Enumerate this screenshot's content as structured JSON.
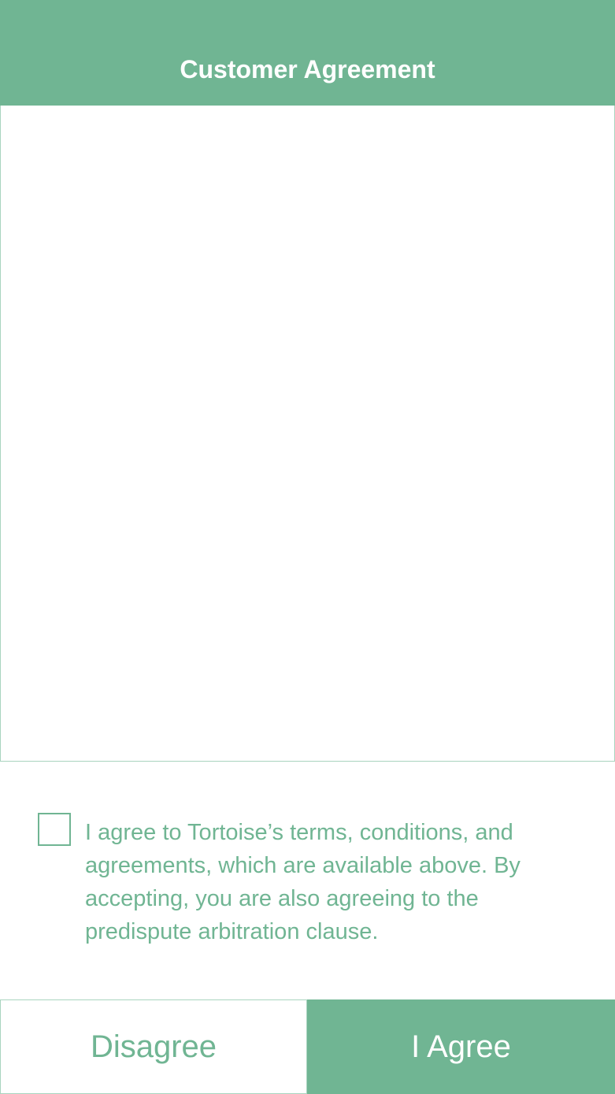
{
  "header": {
    "title": "Customer Agreement"
  },
  "agreement": {
    "body": ""
  },
  "consent": {
    "checked": false,
    "text": "I agree to Tortoise’s terms, conditions, and agreements, which are available above. By accepting, you are also agreeing to the predispute arbitration clause."
  },
  "actions": {
    "disagree_label": "Disagree",
    "agree_label": "I Agree"
  },
  "colors": {
    "accent": "#70b593",
    "border": "#a9d4bf",
    "background": "#ffffff"
  }
}
